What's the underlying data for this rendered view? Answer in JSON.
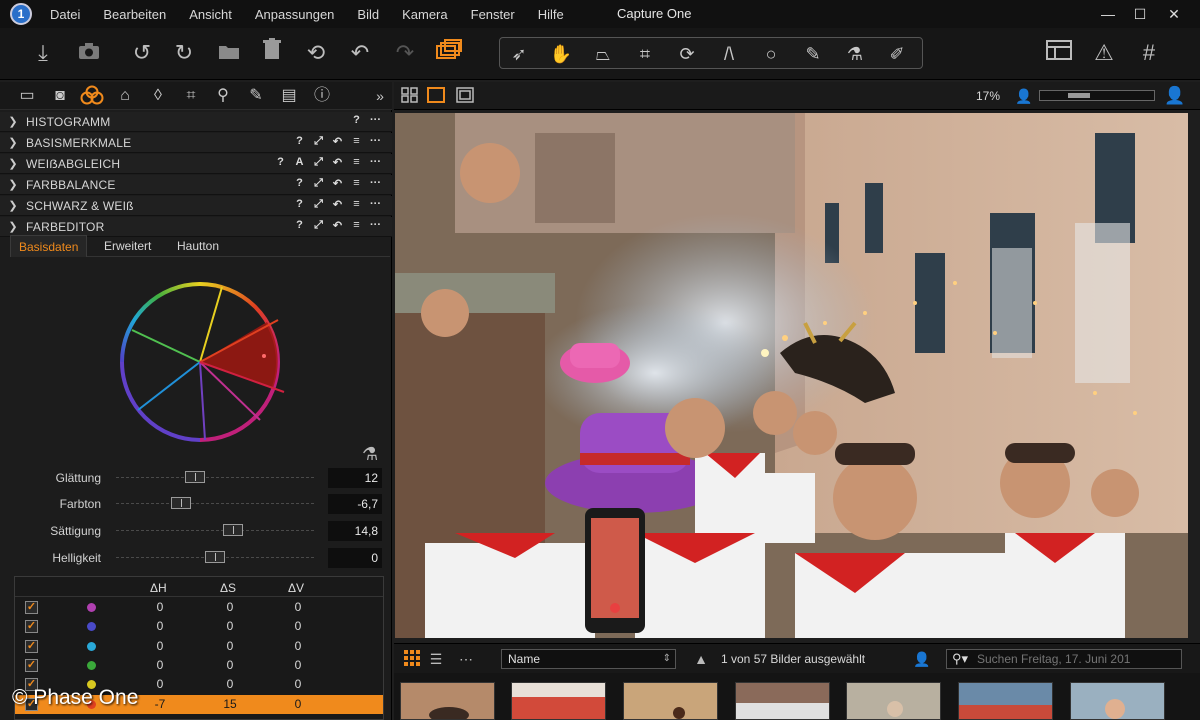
{
  "app": {
    "title": "Capture One",
    "logo_text": "1",
    "menu": [
      "Datei",
      "Bearbeiten",
      "Ansicht",
      "Anpassungen",
      "Bild",
      "Kamera",
      "Fenster",
      "Hilfe"
    ],
    "window_controls": [
      "—",
      "☐",
      "✕"
    ]
  },
  "toolbar": {
    "icons": [
      "import-icon",
      "camera-icon",
      "rotate-left-icon",
      "rotate-right-icon",
      "move-to-icon",
      "trash-icon",
      "undo-all-icon",
      "undo-icon",
      "redo-icon",
      "stack-icon"
    ],
    "tools": [
      "select-cursor-icon",
      "pan-hand-icon",
      "keystone-icon",
      "crop-icon",
      "rotate-tool-icon",
      "straighten-icon",
      "spot-icon",
      "brush-icon",
      "picker-icon",
      "eraser-icon"
    ],
    "right_icons": [
      "workspace-icon",
      "warning-icon",
      "grid-icon"
    ],
    "accent": "#f08a1c"
  },
  "left_panel": {
    "tool_tabs": [
      "library-icon",
      "capture-icon",
      "color-icon",
      "exposure-icon",
      "lens-icon",
      "composition-icon",
      "details-icon",
      "adjust-icon",
      "metadata-icon",
      "info-icon"
    ],
    "expand_glyph": "»",
    "sections": [
      {
        "label": "HISTOGRAMM",
        "icons": [
          "?",
          "···"
        ]
      },
      {
        "label": "BASISMERKMALE",
        "icons": [
          "?",
          "⤢",
          "↶",
          "≡",
          "···"
        ]
      },
      {
        "label": "WEIẞABGLEICH",
        "icons": [
          "?",
          "A",
          "⤢",
          "↶",
          "≡",
          "···"
        ]
      },
      {
        "label": "FARBBALANCE",
        "icons": [
          "?",
          "⤢",
          "↶",
          "≡",
          "···"
        ]
      },
      {
        "label": "SCHWARZ & WEIß",
        "icons": [
          "?",
          "⤢",
          "↶",
          "≡",
          "···"
        ]
      },
      {
        "label": "FARBEDITOR",
        "icons": [
          "?",
          "⤢",
          "↶",
          "≡",
          "···"
        ]
      }
    ],
    "subtabs": [
      "Basisdaten",
      "Erweitert",
      "Hautton"
    ],
    "sliders": [
      {
        "label": "Glättung",
        "value": "12",
        "fraction": 0.4
      },
      {
        "label": "Farbton",
        "value": "-6,7",
        "fraction": 0.33
      },
      {
        "label": "Sättigung",
        "value": "14,8",
        "fraction": 0.59
      },
      {
        "label": "Helligkeit",
        "value": "0",
        "fraction": 0.5
      }
    ],
    "color_table": {
      "headers": [
        "ΔH",
        "ΔS",
        "ΔV"
      ],
      "rows": [
        {
          "color": "#b040b0",
          "dh": "0",
          "ds": "0",
          "dv": "0",
          "selected": false
        },
        {
          "color": "#4a4ac8",
          "dh": "0",
          "ds": "0",
          "dv": "0",
          "selected": false
        },
        {
          "color": "#29a8d8",
          "dh": "0",
          "ds": "0",
          "dv": "0",
          "selected": false
        },
        {
          "color": "#3aa83a",
          "dh": "0",
          "ds": "0",
          "dv": "0",
          "selected": false
        },
        {
          "color": "#d8c820",
          "dh": "0",
          "ds": "0",
          "dv": "0",
          "selected": false
        },
        {
          "color": "#e04020",
          "dh": "-7",
          "ds": "15",
          "dv": "0",
          "selected": true
        }
      ]
    },
    "watermark": "© Phase One"
  },
  "viewer": {
    "zoom": "17%"
  },
  "filmstrip": {
    "sort": "Name",
    "count": "1 von 57 Bilder ausgewählt",
    "search_placeholder": "Suchen Freitag, 17. Juni 201"
  }
}
